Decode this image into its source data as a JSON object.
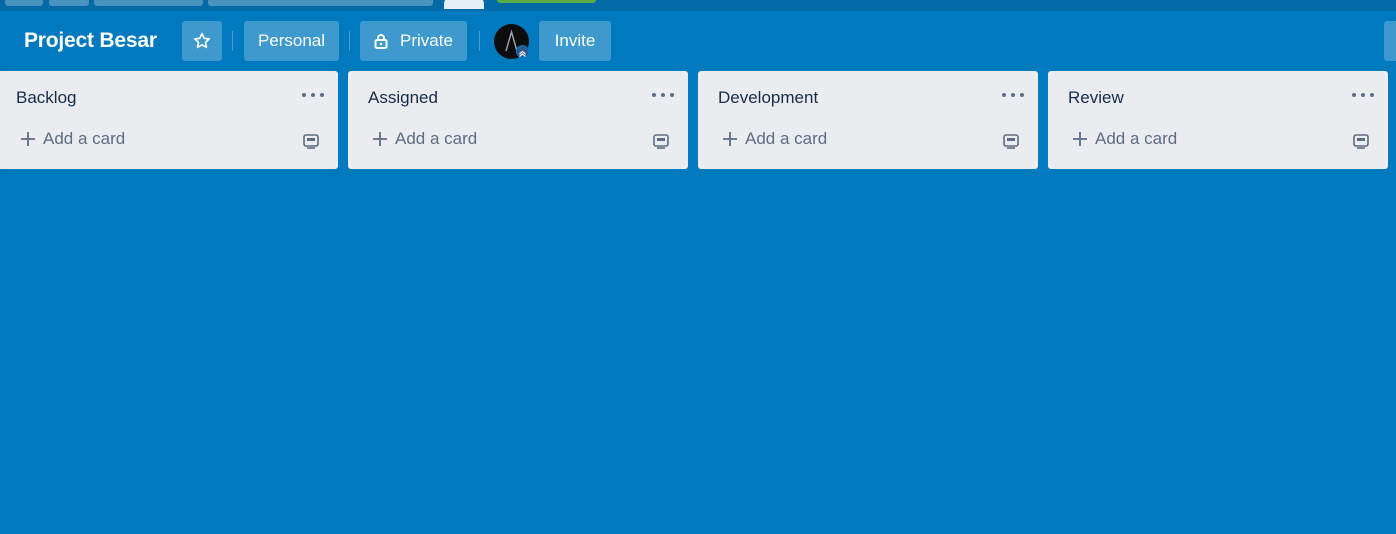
{
  "board": {
    "title": "Project Besar",
    "visibility_workspace": "Personal",
    "visibility_privacy": "Private",
    "invite_label": "Invite"
  },
  "icons": {
    "star": "star-icon",
    "lock": "lock-icon",
    "plus": "plus-icon",
    "more": "more-horizontal-icon",
    "template": "card-template-icon"
  },
  "colors": {
    "board_background": "#0079bf",
    "list_background": "#ebecf0",
    "list_title_text": "#172b4d",
    "muted_text": "#5e6c84"
  },
  "lists": [
    {
      "title": "Backlog",
      "add_card_label": "Add a card"
    },
    {
      "title": "Assigned",
      "add_card_label": "Add a card"
    },
    {
      "title": "Development",
      "add_card_label": "Add a card"
    },
    {
      "title": "Review",
      "add_card_label": "Add a card"
    }
  ]
}
